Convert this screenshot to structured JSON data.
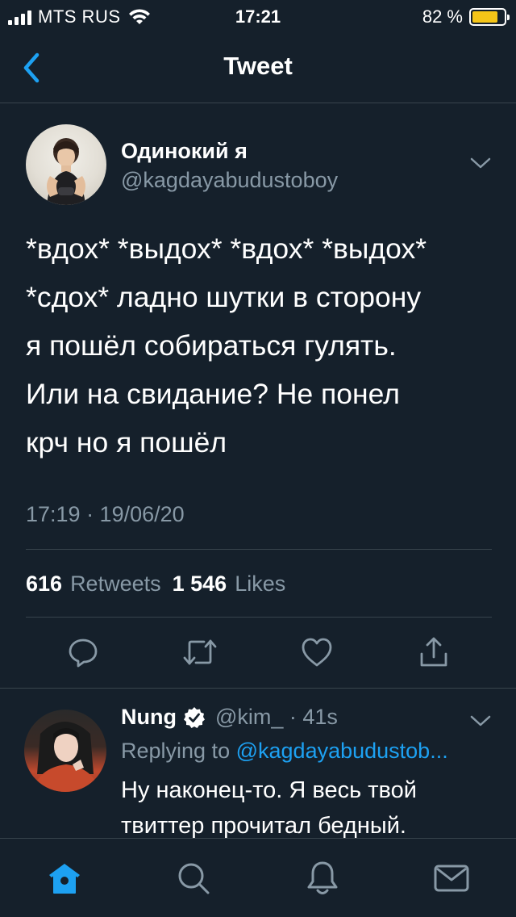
{
  "status_bar": {
    "carrier": "MTS RUS",
    "time": "17:21",
    "battery_percent": "82 %",
    "battery_level": 0.82,
    "signal_bars": 4,
    "colors": {
      "battery_fill": "#f5c518"
    }
  },
  "nav": {
    "title": "Tweet",
    "back_icon": "chevron-left-icon"
  },
  "tweet": {
    "author_name": "Одинокий я",
    "author_handle": "@kagdayabudustoboy",
    "text": "*вдох* *выдох* *вдох* *выдох*\n*сдох* ладно шутки в сторону\nя пошёл собираться гулять.\nИли на свидание? Не понел\nкрч но я пошёл",
    "timestamp": "17:19 · 19/06/20",
    "retweets_count": "616",
    "retweets_label": "Retweets",
    "likes_count": "1 546",
    "likes_label": "Likes",
    "actions": [
      "reply-icon",
      "retweet-icon",
      "like-icon",
      "share-icon"
    ]
  },
  "reply": {
    "author_name": "Nung",
    "author_handle": "@kim_ · 41s",
    "verified": true,
    "replying_prefix": "Replying to",
    "replying_to": "@kagdayabudustob...",
    "text": "Ну наконец-то. Я весь твой\nтвиттер прочитал бедный."
  },
  "tabbar": {
    "items": [
      "home-icon",
      "search-icon",
      "notifications-icon",
      "messages-icon"
    ],
    "active": "home-icon"
  },
  "colors": {
    "background": "#15202b",
    "accent": "#1da1f2",
    "secondary_text": "#8899a6",
    "divider": "#38444d"
  }
}
